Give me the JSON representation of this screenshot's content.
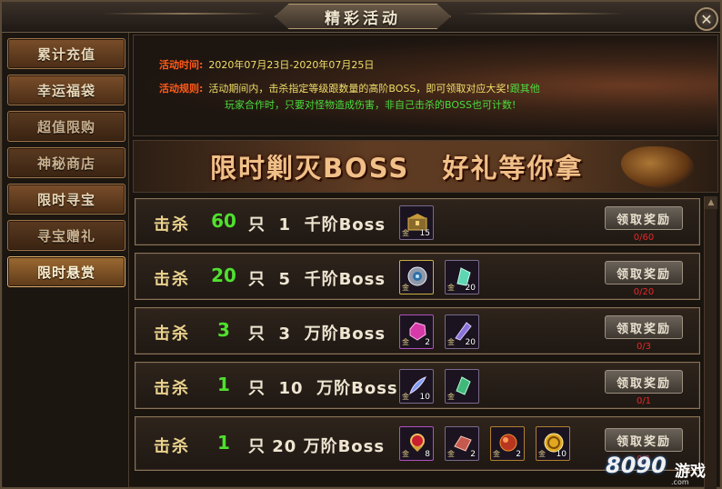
{
  "window": {
    "title": "精彩活动",
    "close_glyph": "✕"
  },
  "sidebar": {
    "items": [
      {
        "label": "累计充值"
      },
      {
        "label": "幸运福袋"
      },
      {
        "label": "超值限购"
      },
      {
        "label": "神秘商店"
      },
      {
        "label": "限时寻宝"
      },
      {
        "label": "寻宝赠礼"
      },
      {
        "label": "限时悬赏",
        "active": true
      }
    ]
  },
  "info": {
    "time_label": "活动时间:",
    "time_value": "2020年07月23日-2020年07月25日",
    "rule_label": "活动规则:",
    "rule_text_1": "活动期间内，击杀指定等级跟数量的高阶BOSS，即可领取对应大奖!",
    "rule_text_1b": "跟其他",
    "rule_text_2": "玩家合作时，只要对怪物造成伤害，非自己击杀的BOSS也可计数!"
  },
  "headline": {
    "text": "限时剿灭BOSS   好礼等你拿"
  },
  "tasks": [
    {
      "kill_label": "击杀",
      "count": "60",
      "boss_text": "只  1  千阶Boss",
      "claim_label": "领取奖励",
      "progress": "0/60",
      "rewards": [
        {
          "icon": "chest-icon",
          "badge": "金",
          "count": "15"
        }
      ]
    },
    {
      "kill_label": "击杀",
      "count": "20",
      "boss_text": "只  5  千阶Boss",
      "claim_label": "领取奖励",
      "progress": "0/20",
      "rewards": [
        {
          "icon": "compass-icon",
          "badge": "金",
          "count": ""
        },
        {
          "icon": "green-crystal-icon",
          "badge": "金",
          "count": "20"
        }
      ]
    },
    {
      "kill_label": "击杀",
      "count": "3",
      "boss_text": "只  3  万阶Boss",
      "claim_label": "领取奖励",
      "progress": "0/3",
      "rewards": [
        {
          "icon": "pink-gem-icon",
          "badge": "金",
          "count": "2"
        },
        {
          "icon": "purple-crystal-icon",
          "badge": "金",
          "count": "20"
        }
      ]
    },
    {
      "kill_label": "击杀",
      "count": "1",
      "boss_text": "只  10  万阶Boss",
      "claim_label": "领取奖励",
      "progress": "0/1",
      "rewards": [
        {
          "icon": "feather-icon",
          "badge": "金",
          "count": "10"
        },
        {
          "icon": "jade-crystal-icon",
          "badge": "金",
          "count": ""
        }
      ]
    },
    {
      "kill_label": "击杀",
      "count": "1",
      "boss_text": "只  20  万阶Boss",
      "claim_label": "领取奖励",
      "progress": "0/1",
      "rewards": [
        {
          "icon": "red-amulet-icon",
          "badge": "金",
          "count": "8"
        },
        {
          "icon": "red-crystal-icon",
          "badge": "金",
          "count": "2"
        },
        {
          "icon": "orb-icon",
          "badge": "金",
          "count": "2"
        },
        {
          "icon": "legend-coin-icon",
          "badge": "金",
          "count": "10"
        }
      ]
    }
  ],
  "watermark": {
    "number": "8090",
    "text": "游戏",
    "sub": ".com"
  },
  "colors": {
    "accent_green": "#4fe02e",
    "progress_red": "#e42a2a",
    "label_orange": "#ff5a1a"
  }
}
